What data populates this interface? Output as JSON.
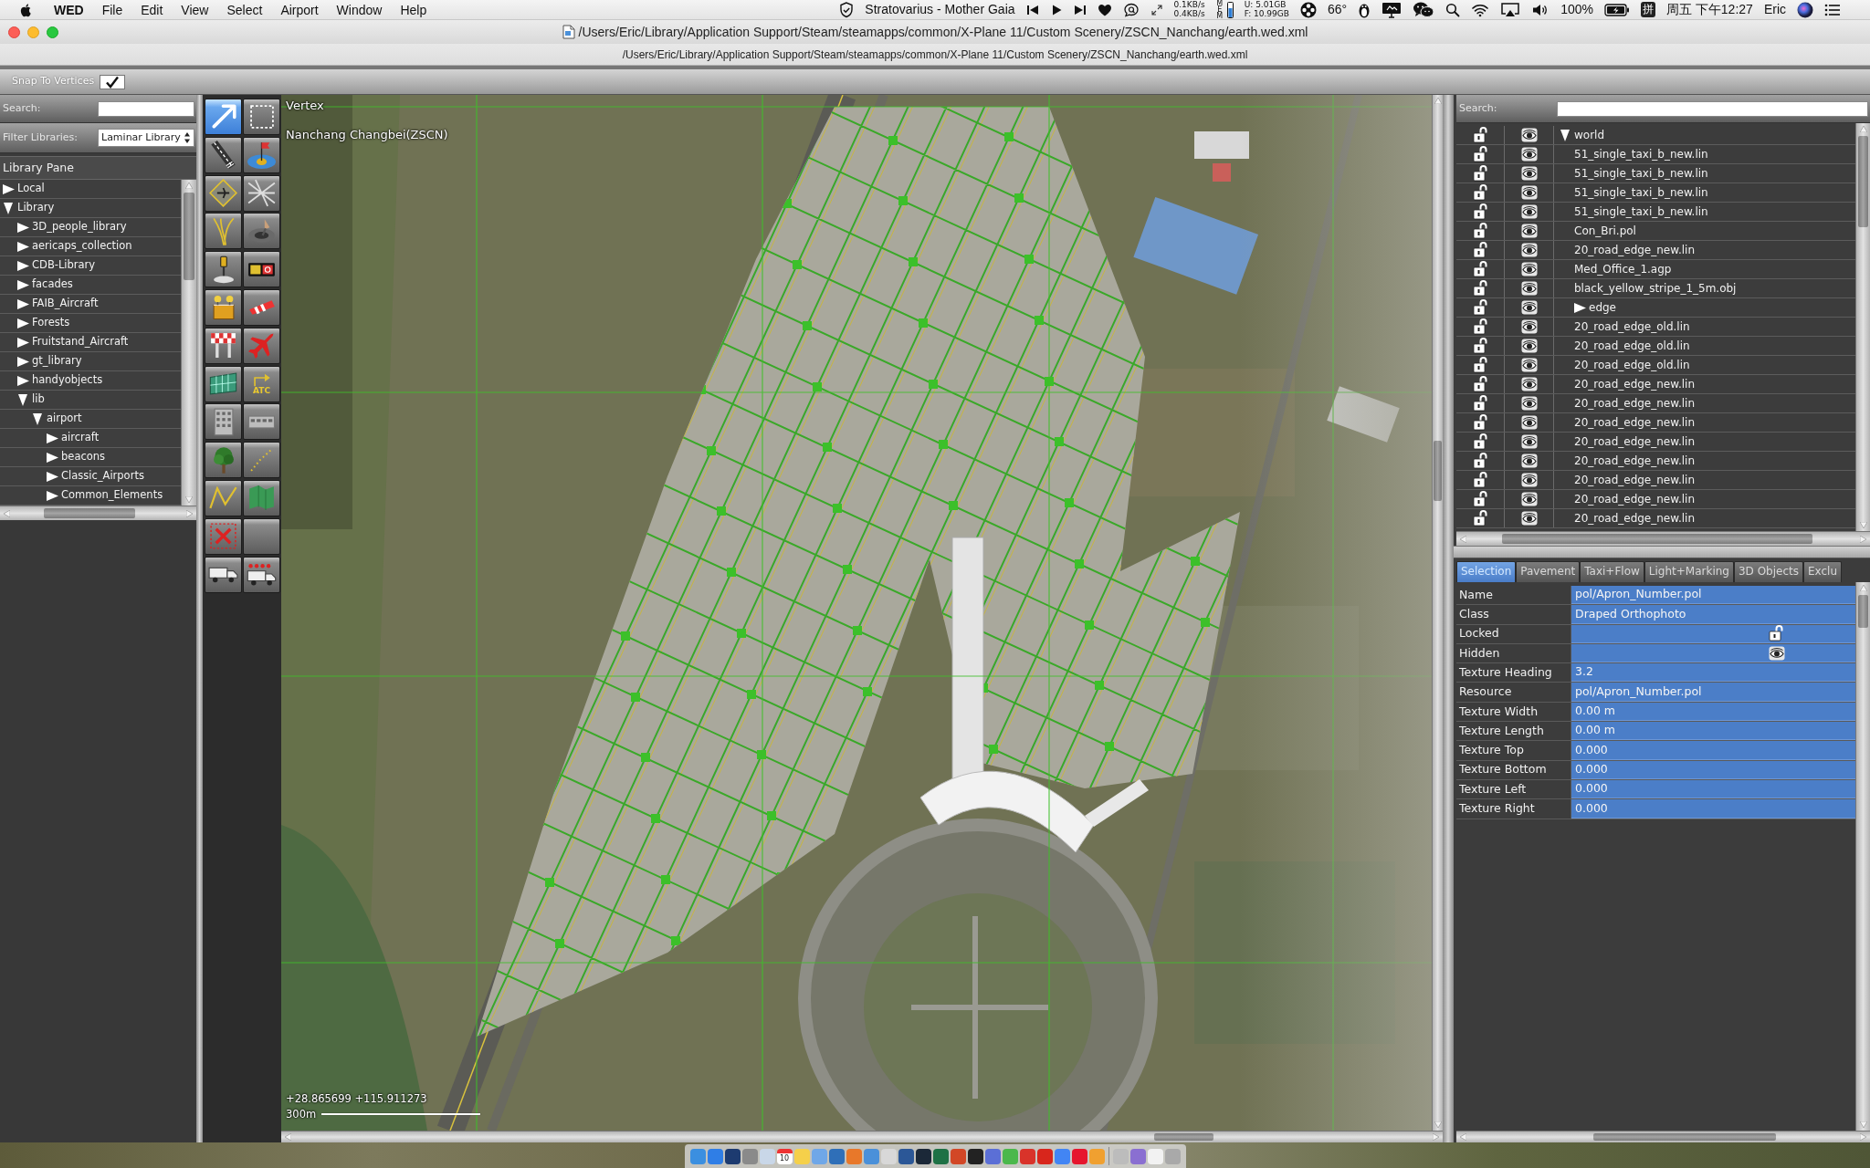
{
  "menu_bar": {
    "app_name": "WED",
    "menus": [
      "File",
      "Edit",
      "View",
      "Select",
      "Airport",
      "Window",
      "Help"
    ],
    "now_playing": "Stratovarius - Mother Gaia",
    "net_upload": "0.1KB/s",
    "net_download": "0.4KB/s",
    "memory_label": "MEM",
    "memory_used": "U: 5.01GB",
    "memory_free": "F: 10.99GB",
    "temperature": "66°",
    "battery": "100%",
    "input_method": "拼",
    "clock": "周五 下午12:27",
    "user": "Eric"
  },
  "window": {
    "title": "/Users/Eric/Library/Application Support/Steam/steamapps/common/X-Plane 11/Custom Scenery/ZSCN_Nanchang/earth.wed.xml",
    "document_path": "/Users/Eric/Library/Application Support/Steam/steamapps/common/X-Plane 11/Custom Scenery/ZSCN_Nanchang/earth.wed.xml"
  },
  "toolbar": {
    "snap_label": "Snap To Vertices",
    "snap_checked": true
  },
  "library_pane": {
    "search_label": "Search:",
    "filter_label": "Filter Libraries:",
    "filter_value": "Laminar Library",
    "title": "Library Pane",
    "tree": [
      {
        "label": "Local",
        "expanded": false
      },
      {
        "label": "Library",
        "expanded": true,
        "children": [
          {
            "label": "3D_people_library",
            "expanded": false
          },
          {
            "label": "aericaps_collection",
            "expanded": false
          },
          {
            "label": "CDB-Library",
            "expanded": false
          },
          {
            "label": "facades",
            "expanded": false
          },
          {
            "label": "FAIB_Aircraft",
            "expanded": false
          },
          {
            "label": "Forests",
            "expanded": false
          },
          {
            "label": "Fruitstand_Aircraft",
            "expanded": false
          },
          {
            "label": "gt_library",
            "expanded": false
          },
          {
            "label": "handyobjects",
            "expanded": false
          },
          {
            "label": "lib",
            "expanded": true,
            "children": [
              {
                "label": "airport",
                "expanded": true,
                "children": [
                  {
                    "label": "aircraft",
                    "expanded": false
                  },
                  {
                    "label": "beacons",
                    "expanded": false
                  },
                  {
                    "label": "Classic_Airports",
                    "expanded": false
                  },
                  {
                    "label": "Common_Elements",
                    "expanded": false
                  }
                ]
              }
            ]
          }
        ]
      }
    ]
  },
  "tools": [
    {
      "selected": true
    },
    {
      "selected": false
    },
    {
      "selected": false
    },
    {
      "selected": false
    },
    {
      "selected": false
    },
    {
      "selected": false
    },
    {
      "selected": false
    },
    {
      "selected": false
    },
    {
      "selected": false
    },
    {
      "selected": false
    },
    {
      "selected": false
    },
    {
      "selected": false
    },
    {
      "selected": false
    },
    {
      "selected": false
    },
    {
      "selected": false
    },
    {
      "selected": false,
      "label": "ATC"
    },
    {
      "selected": false
    },
    {
      "selected": false
    },
    {
      "selected": false
    },
    {
      "selected": false
    },
    {
      "selected": false
    },
    {
      "selected": false
    },
    {
      "selected": false
    },
    {
      "selected": false
    },
    {
      "selected": false
    },
    {
      "selected": false
    }
  ],
  "map": {
    "tool_name": "Vertex",
    "airport": "Nanchang Changbei(ZSCN)",
    "coordinates": "+28.865699 +115.911273",
    "scale": "300m"
  },
  "hierarchy": {
    "search_label": "Search:",
    "tree": [
      {
        "kind": "group",
        "label": "world",
        "expanded": true,
        "locked": false,
        "hidden": false,
        "children": [
          {
            "kind": "file",
            "label": "51_single_taxi_b_new.lin",
            "locked": false,
            "hidden": false
          },
          {
            "kind": "file",
            "label": "51_single_taxi_b_new.lin",
            "locked": false,
            "hidden": false
          },
          {
            "kind": "file",
            "label": "51_single_taxi_b_new.lin",
            "locked": false,
            "hidden": false
          },
          {
            "kind": "file",
            "label": "51_single_taxi_b_new.lin",
            "locked": false,
            "hidden": false
          },
          {
            "kind": "file",
            "label": "Con_Bri.pol",
            "locked": false,
            "hidden": false
          },
          {
            "kind": "file",
            "label": "20_road_edge_new.lin",
            "locked": false,
            "hidden": false
          },
          {
            "kind": "file",
            "label": "Med_Office_1.agp",
            "locked": false,
            "hidden": false
          },
          {
            "kind": "file",
            "label": "black_yellow_stripe_1_5m.obj",
            "locked": false,
            "hidden": false
          },
          {
            "kind": "group",
            "label": "edge",
            "expanded": false,
            "locked": false,
            "hidden": false
          },
          {
            "kind": "file",
            "label": "20_road_edge_old.lin",
            "locked": false,
            "hidden": false
          },
          {
            "kind": "file",
            "label": "20_road_edge_old.lin",
            "locked": false,
            "hidden": false
          },
          {
            "kind": "file",
            "label": "20_road_edge_old.lin",
            "locked": false,
            "hidden": false
          },
          {
            "kind": "file",
            "label": "20_road_edge_new.lin",
            "locked": false,
            "hidden": false
          },
          {
            "kind": "file",
            "label": "20_road_edge_new.lin",
            "locked": false,
            "hidden": false
          },
          {
            "kind": "file",
            "label": "20_road_edge_new.lin",
            "locked": false,
            "hidden": false
          },
          {
            "kind": "file",
            "label": "20_road_edge_new.lin",
            "locked": false,
            "hidden": false
          },
          {
            "kind": "file",
            "label": "20_road_edge_new.lin",
            "locked": false,
            "hidden": false
          },
          {
            "kind": "file",
            "label": "20_road_edge_new.lin",
            "locked": false,
            "hidden": false
          },
          {
            "kind": "file",
            "label": "20_road_edge_new.lin",
            "locked": false,
            "hidden": false
          },
          {
            "kind": "file",
            "label": "20_road_edge_new.lin",
            "locked": false,
            "hidden": false
          }
        ]
      }
    ]
  },
  "property_tabs": [
    {
      "label": "Selection",
      "selected": true
    },
    {
      "label": "Pavement",
      "selected": false
    },
    {
      "label": "Taxi+Flow",
      "selected": false
    },
    {
      "label": "Light+Marking",
      "selected": false
    },
    {
      "label": "3D Objects",
      "selected": false
    },
    {
      "label": "Exclu",
      "selected": false
    }
  ],
  "properties": [
    {
      "kind": "text",
      "label": "Name",
      "value": "pol/Apron_Number.pol"
    },
    {
      "kind": "text",
      "label": "Class",
      "value": "Draped Orthophoto"
    },
    {
      "kind": "lock",
      "label": "Locked",
      "checked": false
    },
    {
      "kind": "eye",
      "label": "Hidden",
      "checked": false
    },
    {
      "kind": "text",
      "label": "Texture Heading",
      "value": "3.2"
    },
    {
      "kind": "text",
      "label": "Resource",
      "value": "pol/Apron_Number.pol"
    },
    {
      "kind": "text",
      "label": "Texture Width",
      "value": "0.00 m"
    },
    {
      "kind": "text",
      "label": "Texture Length",
      "value": "0.00 m"
    },
    {
      "kind": "text",
      "label": "Texture Top",
      "value": "0.000"
    },
    {
      "kind": "text",
      "label": "Texture Bottom",
      "value": "0.000"
    },
    {
      "kind": "text",
      "label": "Texture Left",
      "value": "0.000"
    },
    {
      "kind": "text",
      "label": "Texture Right",
      "value": "0.000"
    }
  ],
  "dock": {
    "calendar_day": "10"
  }
}
